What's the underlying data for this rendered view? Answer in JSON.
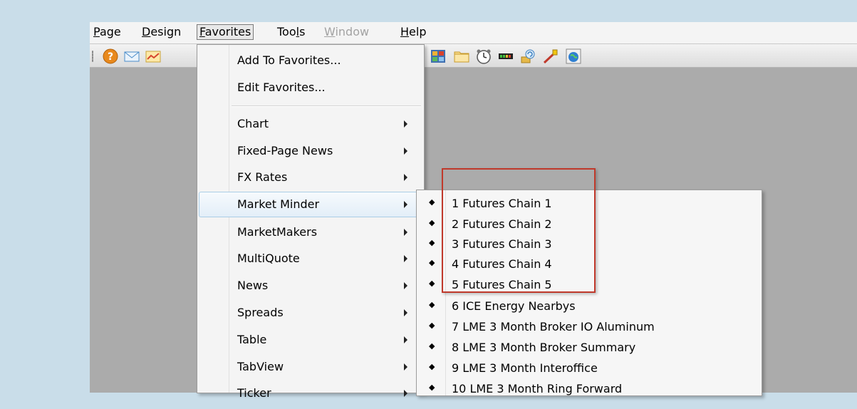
{
  "menubar": {
    "items": [
      {
        "pre": "",
        "mn": "P",
        "post": "age"
      },
      {
        "pre": "",
        "mn": "D",
        "post": "esign"
      },
      {
        "pre": "",
        "mn": "F",
        "post": "avorites"
      },
      {
        "pre": "Too",
        "mn": "l",
        "post": "s"
      },
      {
        "pre": "",
        "mn": "W",
        "post": "indow"
      },
      {
        "pre": "",
        "mn": "H",
        "post": "elp"
      }
    ]
  },
  "toolbar": {
    "icons": [
      "help-icon",
      "mail-icon",
      "chart-icon",
      "grid-icon",
      "folder-icon",
      "clock-icon",
      "ticker-icon",
      "refresh-icon",
      "pen-icon",
      "globe-icon"
    ]
  },
  "favorites_menu": {
    "add": "Add To Favorites...",
    "edit": "Edit Favorites...",
    "items": [
      "Chart",
      "Fixed-Page News",
      "FX Rates",
      "Market Minder",
      "MarketMakers",
      "MultiQuote",
      "News",
      "Spreads",
      "Table",
      "TabView",
      "Ticker"
    ]
  },
  "market_minder_menu": {
    "bullet": "◆",
    "items": [
      "1 Futures Chain 1",
      "2 Futures Chain 2",
      "3 Futures Chain 3",
      "4 Futures Chain 4",
      "5 Futures Chain 5",
      "6 ICE Energy Nearbys",
      "7 LME 3 Month Broker IO Aluminum",
      "8 LME 3 Month Broker Summary",
      "9 LME 3 Month Interoffice",
      "10 LME 3 Month Ring Forward"
    ]
  },
  "colors": {
    "highlight_box": "#c0392b",
    "hover_item": "#e3eef8"
  }
}
